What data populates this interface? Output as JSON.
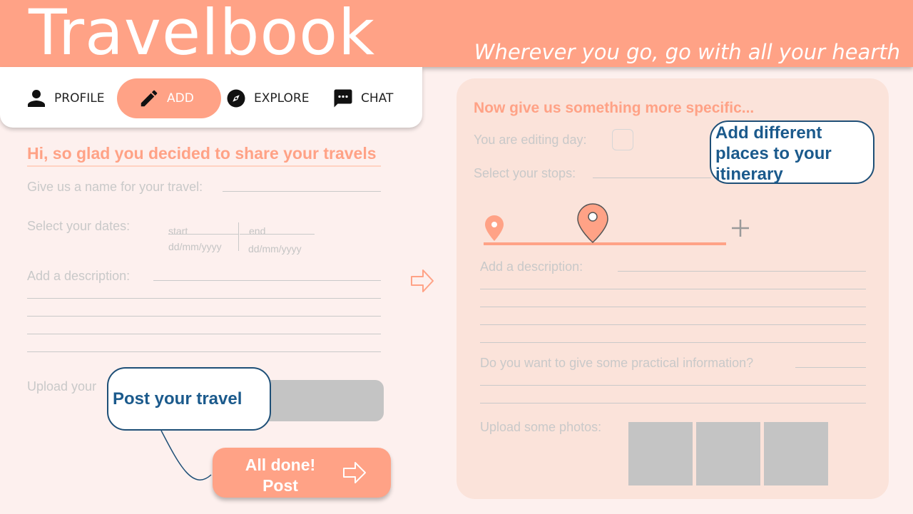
{
  "header": {
    "title": "Travelbook",
    "tagline": "Wherever you go, go with all your hearth"
  },
  "nav": {
    "items": [
      {
        "label": "PROFILE",
        "icon": "person-icon"
      },
      {
        "label": "ADD",
        "icon": "pencil-icon",
        "active": true
      },
      {
        "label": "EXPLORE",
        "icon": "compass-icon"
      },
      {
        "label": "CHAT",
        "icon": "chat-icon"
      }
    ]
  },
  "form": {
    "welcome": "Hi, so glad you decided to share your travels",
    "name_label": "Give us a name for your travel:",
    "dates_label": "Select your dates:",
    "start_label": "start",
    "start_placeholder": "dd/mm/yyyy",
    "end_label": "end",
    "end_placeholder": "dd/mm/yyyy",
    "description_label": "Add a description:",
    "upload_label": "Upload your",
    "post_button": {
      "line1": "All done!",
      "line2": "Post"
    }
  },
  "details": {
    "title": "Now give us something more specific...",
    "editing_day_label": "You are editing day:",
    "stops_label": "Select your stops:",
    "description_label": "Add a description:",
    "practical_label": "Do you want to give some practical information?",
    "photos_label": "Upload some photos:"
  },
  "tooltips": {
    "post": "Post your travel",
    "add_places": "Add different places to your itinerary"
  },
  "colors": {
    "accent": "#ffa286",
    "card": "#fbe3da",
    "background": "#fdf0ee",
    "tooltip_text": "#1b5a8c"
  }
}
